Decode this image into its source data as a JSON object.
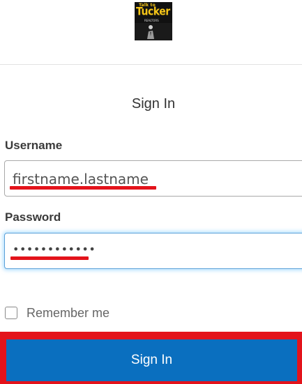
{
  "brand": {
    "logo_small": "Talk to",
    "logo_big": "Tucker",
    "logo_tag": "REALTORS",
    "logo_bg": "#111111",
    "logo_accent": "#f5c518"
  },
  "form": {
    "title": "Sign In",
    "username_label": "Username",
    "username_value": "firstname.lastname",
    "password_label": "Password",
    "password_value": "••••••••••••",
    "remember_label": "Remember me",
    "remember_checked": false,
    "submit_label": "Sign In"
  },
  "colors": {
    "primary_button": "#0a6fbf",
    "annotation_red": "#e3131b",
    "focus_glow": "#78c8ff"
  }
}
